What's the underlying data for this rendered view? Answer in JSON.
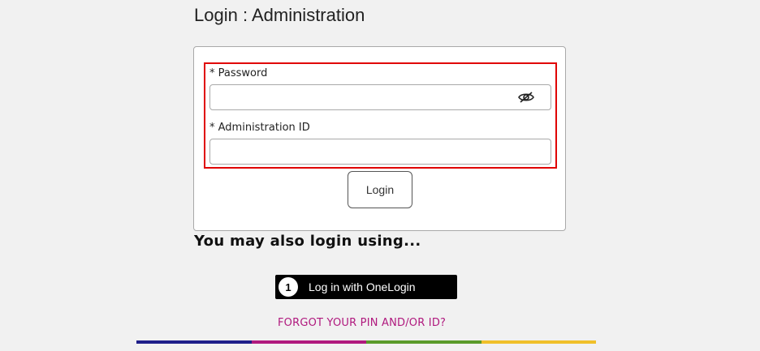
{
  "page": {
    "title": "Login : Administration"
  },
  "form": {
    "password_label": "* Password",
    "password_value": "",
    "admin_id_label": "* Administration ID",
    "admin_id_value": "",
    "login_label": "Login",
    "eye_icon": "eye-slash-icon"
  },
  "alternate": {
    "heading": "You may also login using...",
    "onelogin_icon_text": "1",
    "onelogin_label": "Log in with OneLogin"
  },
  "forgot": {
    "label": "FORGOT YOUR PIN AND/OR ID?"
  },
  "colors": {
    "highlight": "#e00000",
    "link": "#b0197e",
    "bar": [
      "#1f1f8a",
      "#b0197e",
      "#5a9a2a",
      "#f0c02a"
    ]
  }
}
